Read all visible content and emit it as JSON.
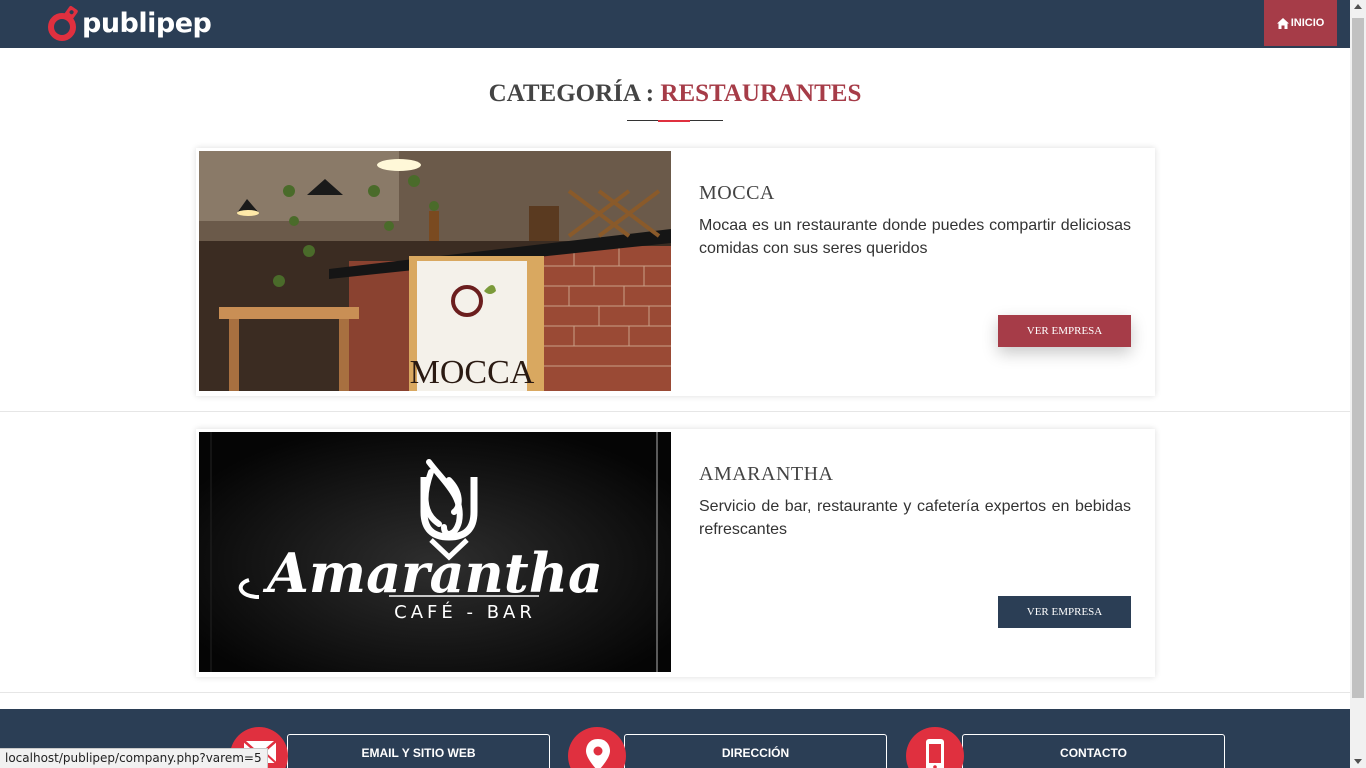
{
  "brand": {
    "name": "publipep",
    "accent": "#e0303f",
    "navy": "#2b3e55",
    "burgundy": "#a63c48"
  },
  "nav": {
    "inicio_label": "INICIO",
    "inicio_icon": "home-icon"
  },
  "page": {
    "title_prefix": "CATEGORÍA : ",
    "category": "RESTAURANTES"
  },
  "companies": [
    {
      "name": "MOCCA",
      "description": "Mocaa es un restaurante donde puedes compartir deliciosas comidas con sus seres queridos",
      "button_label": "VER EMPRESA",
      "image_sign_text": "MOCCA"
    },
    {
      "name": "AMARANTHA",
      "description": "Servicio de bar, restaurante y cafetería expertos en bebidas refrescantes",
      "button_label": "VER EMPRESA",
      "logo_script": "Amarantha",
      "logo_sub": "CAFÉ - BAR"
    }
  ],
  "footer": {
    "items": [
      {
        "label": "EMAIL Y SITIO WEB",
        "icon": "envelope-icon"
      },
      {
        "label": "DIRECCIÓN",
        "icon": "map-pin-icon"
      },
      {
        "label": "CONTACTO",
        "icon": "phone-icon"
      }
    ]
  },
  "status_bar": {
    "url": "localhost/publipep/company.php?varem=5"
  }
}
